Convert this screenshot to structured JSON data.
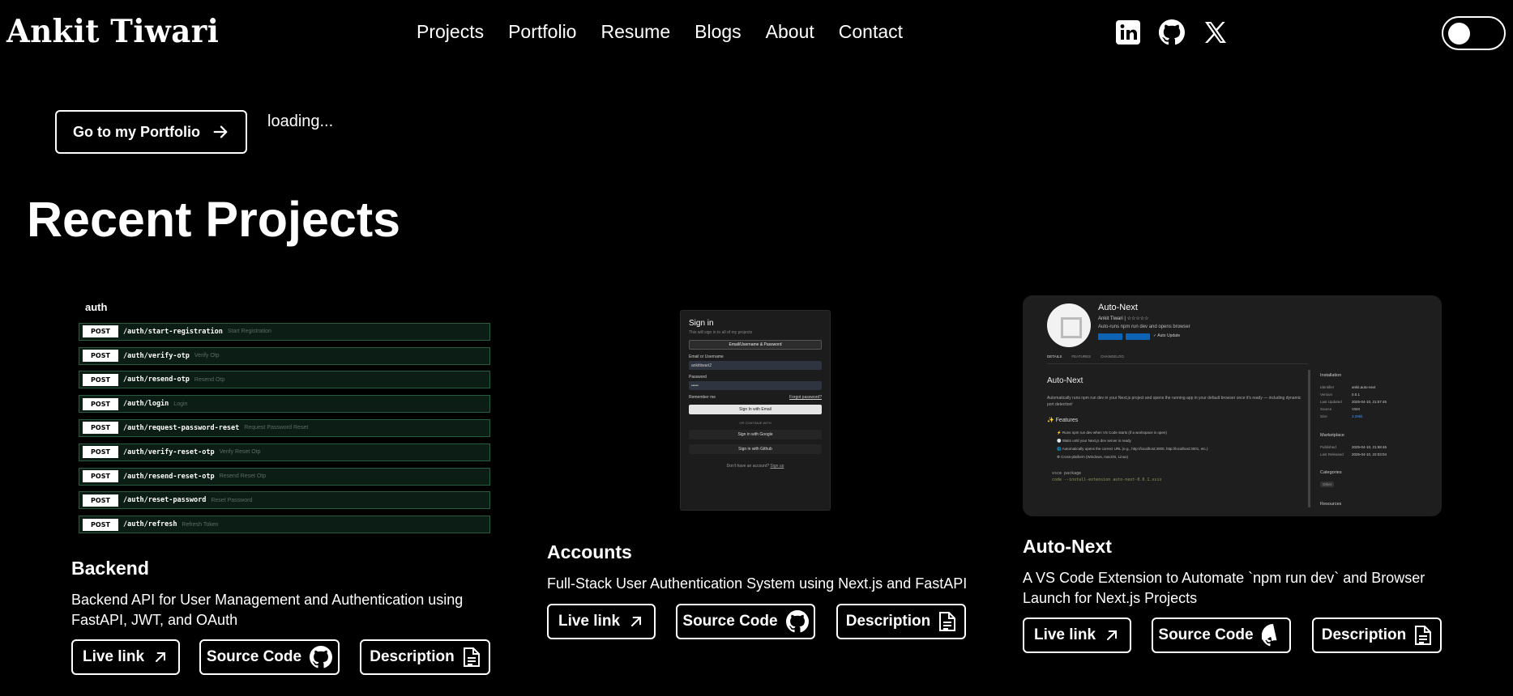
{
  "nav": {
    "logo": "Ankit Tiwari",
    "links": [
      "Projects",
      "Portfolio",
      "Resume",
      "Blogs",
      "About",
      "Contact"
    ],
    "socials": [
      "linkedin-icon",
      "github-icon",
      "x-icon"
    ]
  },
  "hero": {
    "portfolio_button": "Go to my Portfolio",
    "loading_text": "loading..."
  },
  "section_title": "Recent Projects",
  "projects": [
    {
      "title": "Backend",
      "description": "Backend API for User Management and Authentication using FastAPI, JWT, and OAuth",
      "live_label": "Live link",
      "source_label": "Source Code",
      "desc_label": "Description",
      "thumbnail": {
        "group": "auth",
        "endpoints": [
          {
            "method": "POST",
            "path": "/auth/start-registration",
            "summary": "Start Registration"
          },
          {
            "method": "POST",
            "path": "/auth/verify-otp",
            "summary": "Verify Otp"
          },
          {
            "method": "POST",
            "path": "/auth/resend-otp",
            "summary": "Resend Otp"
          },
          {
            "method": "POST",
            "path": "/auth/login",
            "summary": "Login"
          },
          {
            "method": "POST",
            "path": "/auth/request-password-reset",
            "summary": "Request Password Reset"
          },
          {
            "method": "POST",
            "path": "/auth/verify-reset-otp",
            "summary": "Verify Reset Otp"
          },
          {
            "method": "POST",
            "path": "/auth/resend-reset-otp",
            "summary": "Resend Reset Otp"
          },
          {
            "method": "POST",
            "path": "/auth/reset-password",
            "summary": "Reset Password"
          },
          {
            "method": "POST",
            "path": "/auth/refresh",
            "summary": "Refresh Token"
          }
        ]
      }
    },
    {
      "title": "Accounts",
      "description": "Full-Stack User Authentication System using Next.js and FastAPI",
      "live_label": "Live link",
      "source_label": "Source Code",
      "desc_label": "Description",
      "thumbnail": {
        "title": "Sign in",
        "subtitle": "This will sign in to all of my projects",
        "mode_button": "Email/Username & Password",
        "email_label": "Email or Username",
        "email_value": "ankittiwari2",
        "password_label": "Password",
        "password_value": "•••••",
        "remember": "Remember me",
        "forgot": "Forgot password?",
        "primary": "Sign In with Email",
        "or": "OR CONTINUE WITH",
        "google": "Sign in with Google",
        "github": "Sign in with Github",
        "footer": "Don't have an account?",
        "signup": "Sign up"
      }
    },
    {
      "title": "Auto-Next",
      "description": "A VS Code Extension to Automate `npm run dev` and Browser Launch for Next.js Projects",
      "live_label": "Live link",
      "source_label": "Source Code",
      "desc_label": "Description",
      "thumbnail": {
        "name": "Auto-Next",
        "author": "Ankit Tiwari | ☆☆☆☆☆",
        "short": "Auto-runs npm run dev and opens browser",
        "auto_update": "✓ Auto Update",
        "tabs": [
          "DETAILS",
          "FEATURES",
          "CHANGELOG"
        ],
        "heading": "Auto-Next",
        "para": "Automatically runs npm run dev in your Next.js project and opens the running app in your default browser once it's ready — including dynamic port detection!",
        "features_title": "✨ Features",
        "features": [
          "⚡ Runs npm run dev when VS Code starts (if a workspace is open)",
          "🕐 Waits until your Next.js dev server is ready",
          "🌐 Automatically opens the correct URL (e.g., http://localhost:3000, http://localhost:3001, etc.)",
          "⚙ Cross-platform (Windows, macOS, Linux)"
        ],
        "code": [
          "vsce package",
          "code --install-extension auto-next-0.0.1.vsix"
        ],
        "installation_title": "Installation",
        "installation": [
          [
            "Identifier",
            "ankit.auto-next"
          ],
          [
            "Version",
            "0.0.1"
          ],
          [
            "Last Updated",
            "2025-04-10, 21:57:45"
          ],
          [
            "Source",
            "VSIX"
          ],
          [
            "Size",
            "3.29kb"
          ]
        ],
        "marketplace_title": "Marketplace",
        "marketplace": [
          [
            "Published",
            "2025-04-10, 21:58:46"
          ],
          [
            "Last Released",
            "2025-04-10, 22:03:04"
          ]
        ],
        "categories_title": "Categories",
        "category": "Other",
        "resources_title": "Resources"
      }
    }
  ]
}
